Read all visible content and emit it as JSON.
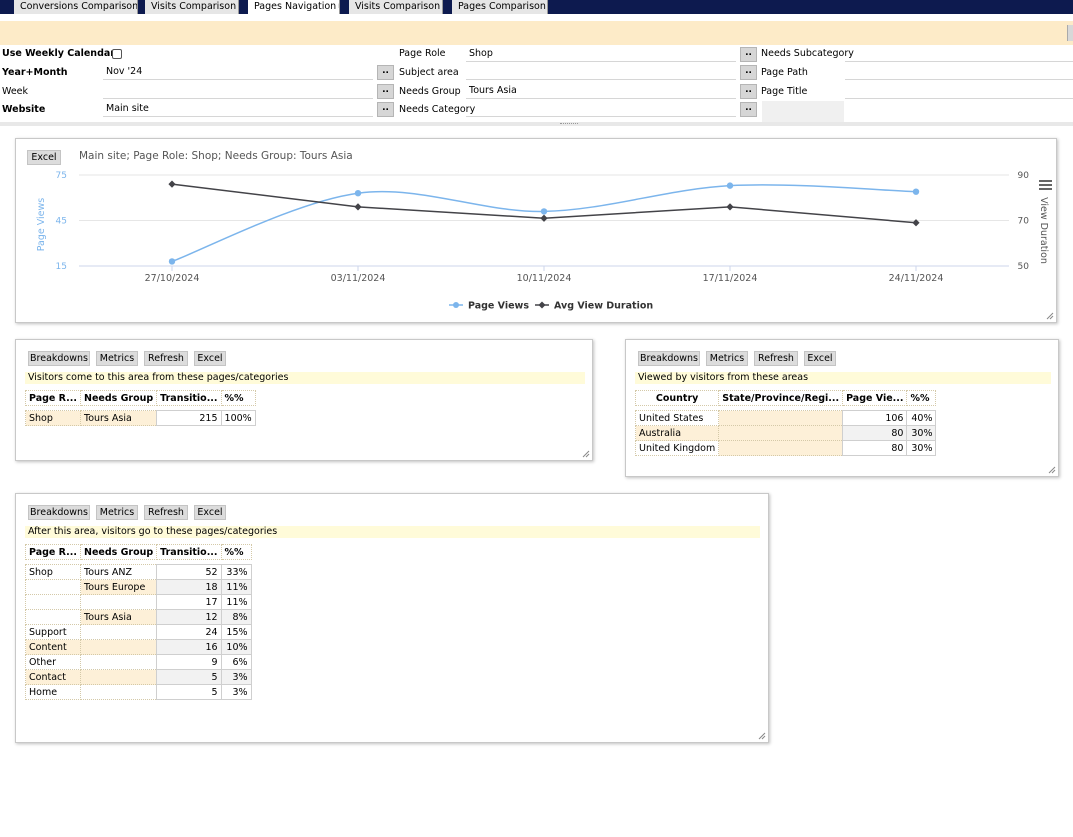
{
  "tabs": [
    {
      "label": "Conversions Comparison",
      "active": false
    },
    {
      "label": "Visits Comparison",
      "active": false
    },
    {
      "label": "Pages Navigation",
      "active": true
    },
    {
      "label": "Visits Comparison",
      "active": false
    },
    {
      "label": "Pages Comparison",
      "active": false
    }
  ],
  "filters": {
    "use_weekly_calendar": "Use Weekly Calendar",
    "year_month": "Year+Month",
    "year_month_value": "Nov '24",
    "week": "Week",
    "week_value": "",
    "website": "Website",
    "website_value": "Main site",
    "page_role": "Page Role",
    "page_role_value": "Shop",
    "subject_area": "Subject area",
    "subject_area_value": "",
    "needs_group": "Needs Group",
    "needs_group_value": "Tours Asia",
    "needs_category": "Needs Category",
    "needs_category_value": "",
    "needs_subcategory": "Needs Subcategory",
    "needs_subcategory_value": "",
    "page_path": "Page Path",
    "page_path_value": "",
    "page_title": "Page Title",
    "page_title_value": "",
    "dots": ".."
  },
  "chart_panel": {
    "excel_label": "Excel",
    "title": "Main site; Page Role: Shop; Needs Group: Tours Asia"
  },
  "chart_data": {
    "type": "line",
    "title": "Main site; Page Role: Shop; Needs Group: Tours Asia",
    "categories": [
      "27/10/2024",
      "03/11/2024",
      "10/11/2024",
      "17/11/2024",
      "24/11/2024"
    ],
    "series": [
      {
        "name": "Page Views",
        "values": [
          18,
          63,
          51,
          68,
          64
        ],
        "axis": "left",
        "color": "#7cb5ec"
      },
      {
        "name": "Avg View Duration",
        "values": [
          86,
          76,
          71,
          76,
          69
        ],
        "axis": "right",
        "color": "#434348"
      }
    ],
    "ylabel": "Page Views",
    "ylim": [
      15,
      75
    ],
    "yticks": [
      15,
      45,
      75
    ],
    "y2label": "View Duration",
    "y2lim": [
      50,
      90
    ],
    "y2ticks": [
      50,
      70,
      90
    ],
    "grid": true,
    "legend": "bottom-center"
  },
  "panel_from": {
    "buttons": [
      "Breakdowns",
      "Metrics",
      "Refresh",
      "Excel"
    ],
    "caption": "Visitors come to this area from these pages/categories",
    "headers": [
      "Page R...",
      "Needs Group",
      "Transitio...",
      "%%"
    ],
    "rows": [
      [
        "Shop",
        "Tours Asia",
        "215",
        "100%"
      ]
    ]
  },
  "panel_geo": {
    "buttons": [
      "Breakdowns",
      "Metrics",
      "Refresh",
      "Excel"
    ],
    "caption": "Viewed by visitors from these areas",
    "headers": [
      "Country",
      "State/Province/Regi...",
      "Page Vie...",
      "%%"
    ],
    "rows": [
      [
        "United States",
        "",
        "106",
        "40%"
      ],
      [
        "Australia",
        "",
        "80",
        "30%"
      ],
      [
        "United Kingdom",
        "",
        "80",
        "30%"
      ]
    ]
  },
  "panel_to": {
    "buttons": [
      "Breakdowns",
      "Metrics",
      "Refresh",
      "Excel"
    ],
    "caption": "After this area, visitors go to these pages/categories",
    "headers": [
      "Page R...",
      "Needs Group",
      "Transitio...",
      "%%"
    ],
    "rows": [
      [
        "Shop",
        "Tours ANZ",
        "52",
        "33%"
      ],
      [
        "",
        "Tours Europe",
        "18",
        "11%"
      ],
      [
        "",
        "",
        "17",
        "11%"
      ],
      [
        "",
        "Tours Asia",
        "12",
        "8%"
      ],
      [
        "Support",
        "",
        "24",
        "15%"
      ],
      [
        "Content",
        "",
        "16",
        "10%"
      ],
      [
        "Other",
        "",
        "9",
        "6%"
      ],
      [
        "Contact",
        "",
        "5",
        "3%"
      ],
      [
        "Home",
        "",
        "5",
        "3%"
      ]
    ]
  }
}
